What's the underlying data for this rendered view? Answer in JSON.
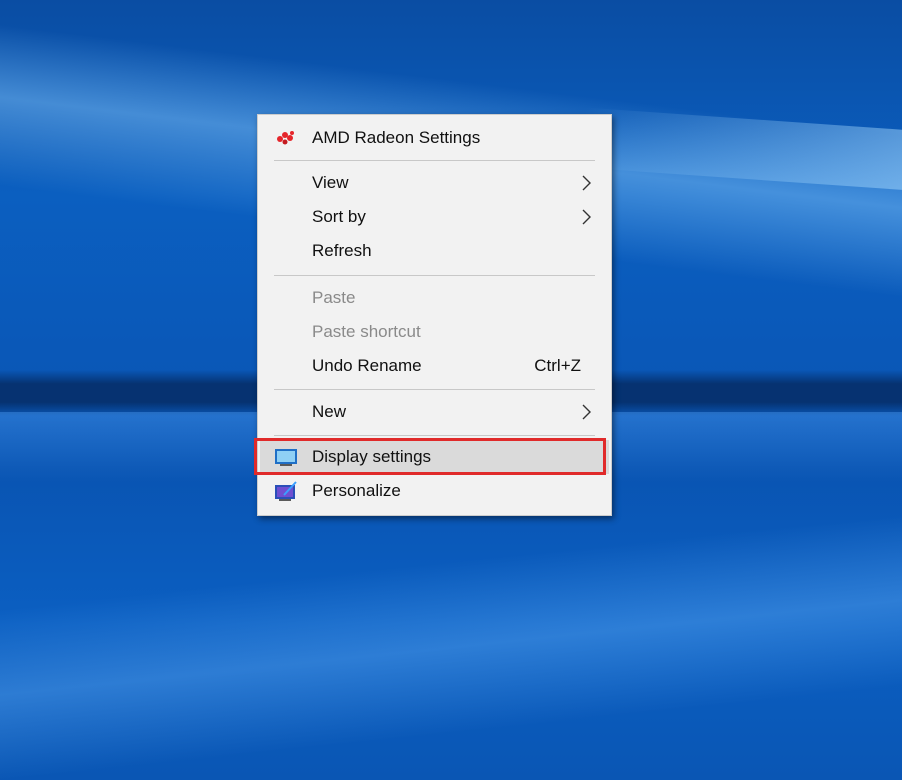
{
  "context_menu": {
    "items": [
      {
        "label": "AMD Radeon Settings",
        "icon": "amd-radeon-icon"
      },
      {
        "label": "View",
        "submenu": true
      },
      {
        "label": "Sort by",
        "submenu": true
      },
      {
        "label": "Refresh"
      },
      {
        "label": "Paste",
        "disabled": true
      },
      {
        "label": "Paste shortcut",
        "disabled": true
      },
      {
        "label": "Undo Rename",
        "shortcut": "Ctrl+Z"
      },
      {
        "label": "New",
        "submenu": true
      },
      {
        "label": "Display settings",
        "icon": "display-icon",
        "highlighted": true
      },
      {
        "label": "Personalize",
        "icon": "personalize-icon"
      }
    ]
  },
  "colors": {
    "highlight_border": "#e02a2a",
    "menu_background": "#f2f2f2",
    "disabled_text": "#8a8a8a",
    "amd_red": "#e5262b"
  }
}
